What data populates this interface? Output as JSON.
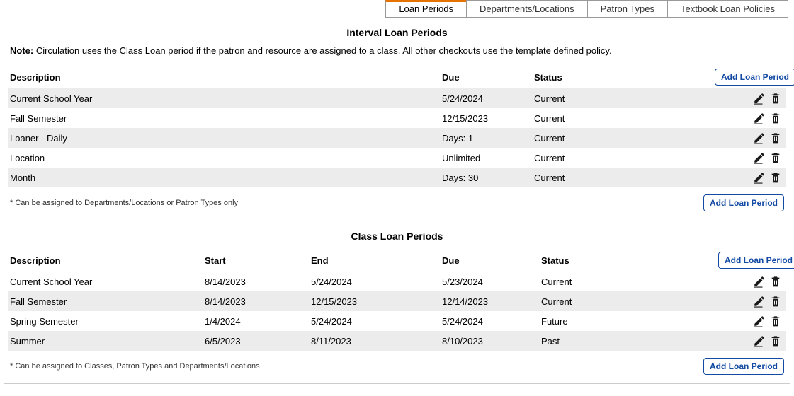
{
  "tabs": [
    {
      "label": "Loan Periods",
      "active": true
    },
    {
      "label": "Departments/Locations",
      "active": false
    },
    {
      "label": "Patron Types",
      "active": false
    },
    {
      "label": "Textbook Loan Policies",
      "active": false
    }
  ],
  "interval": {
    "title": "Interval Loan Periods",
    "note_prefix": "Note:",
    "note_text": " Circulation uses the Class Loan period if the patron and resource are assigned to a class. All other checkouts use the template defined policy.",
    "headers": {
      "description": "Description",
      "due": "Due",
      "status": "Status"
    },
    "add_label": "Add Loan Period",
    "rows": [
      {
        "description": "Current School Year",
        "due": "5/24/2024",
        "status": "Current"
      },
      {
        "description": "Fall Semester",
        "due": "12/15/2023",
        "status": "Current"
      },
      {
        "description": "Loaner - Daily",
        "due": "Days: 1",
        "status": "Current"
      },
      {
        "description": "Location",
        "due": "Unlimited",
        "status": "Current"
      },
      {
        "description": "Month",
        "due": "Days: 30",
        "status": "Current"
      }
    ],
    "footnote": "* Can be assigned to Departments/Locations or Patron Types only"
  },
  "class": {
    "title": "Class Loan Periods",
    "headers": {
      "description": "Description",
      "start": "Start",
      "end": "End",
      "due": "Due",
      "status": "Status"
    },
    "add_label": "Add Loan Period",
    "rows": [
      {
        "description": "Current School Year",
        "start": "8/14/2023",
        "end": "5/24/2024",
        "due": "5/23/2024",
        "status": "Current"
      },
      {
        "description": "Fall Semester",
        "start": "8/14/2023",
        "end": "12/15/2023",
        "due": "12/14/2023",
        "status": "Current"
      },
      {
        "description": "Spring Semester",
        "start": "1/4/2024",
        "end": "5/24/2024",
        "due": "5/24/2024",
        "status": "Future"
      },
      {
        "description": "Summer",
        "start": "6/5/2023",
        "end": "8/11/2023",
        "due": "8/10/2023",
        "status": "Past"
      }
    ],
    "footnote": "* Can be assigned to Classes, Patron Types and Departments/Locations"
  },
  "colors": {
    "accent_orange": "#e67300",
    "accent_blue": "#1149a3",
    "icon_dark": "#1a1a1a"
  }
}
